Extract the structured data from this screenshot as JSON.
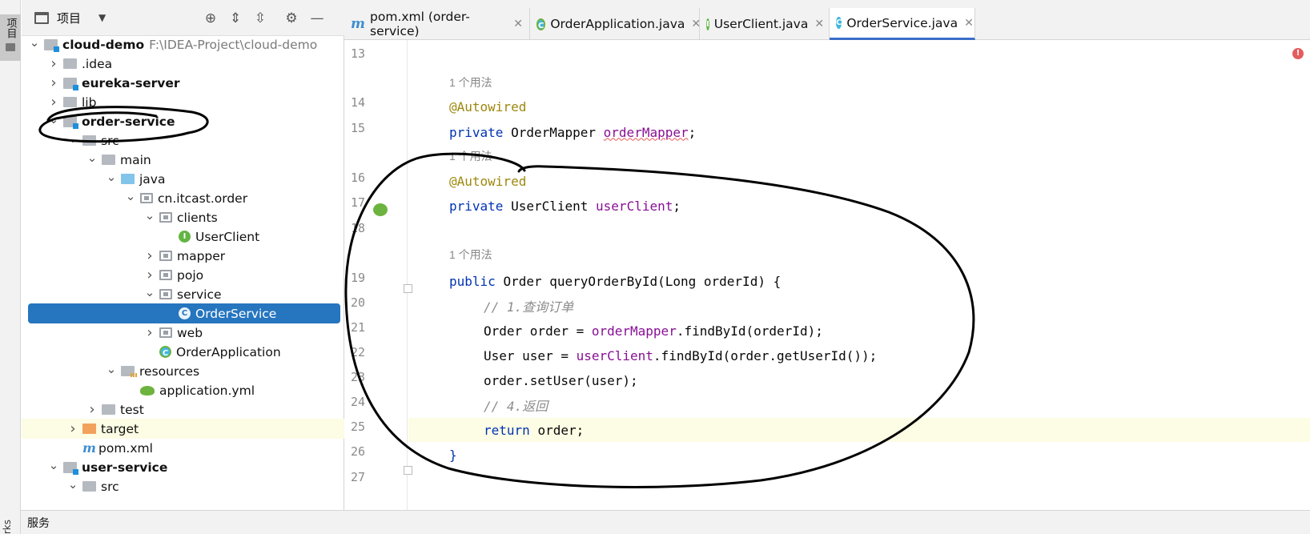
{
  "tool_strip": {
    "project_tab": "项目",
    "bottom_label": "rks"
  },
  "project_panel": {
    "title": "项目",
    "tree": [
      {
        "label": "cloud-demo",
        "path": "F:\\IDEA-Project\\cloud-demo",
        "bold": true,
        "expanded": true,
        "icon": "module-icon"
      },
      {
        "label": ".idea",
        "expanded": false,
        "icon": "folder-icon"
      },
      {
        "label": "eureka-server",
        "bold": true,
        "expanded": false,
        "icon": "module-icon"
      },
      {
        "label": "lib",
        "expanded": false,
        "icon": "folder-icon"
      },
      {
        "label": "order-service",
        "bold": true,
        "expanded": true,
        "icon": "module-icon"
      },
      {
        "label": "src",
        "expanded": true,
        "icon": "folder-icon"
      },
      {
        "label": "main",
        "expanded": true,
        "icon": "folder-icon"
      },
      {
        "label": "java",
        "expanded": true,
        "icon": "source-folder-icon"
      },
      {
        "label": "cn.itcast.order",
        "expanded": true,
        "icon": "package-icon"
      },
      {
        "label": "clients",
        "expanded": true,
        "icon": "package-icon"
      },
      {
        "label": "UserClient",
        "icon": "interface-icon"
      },
      {
        "label": "mapper",
        "expanded": false,
        "icon": "package-icon"
      },
      {
        "label": "pojo",
        "expanded": false,
        "icon": "package-icon"
      },
      {
        "label": "service",
        "expanded": true,
        "icon": "package-icon"
      },
      {
        "label": "OrderService",
        "icon": "class-icon",
        "selected": true
      },
      {
        "label": "web",
        "expanded": false,
        "icon": "package-icon"
      },
      {
        "label": "OrderApplication",
        "icon": "spring-class-icon"
      },
      {
        "label": "resources",
        "expanded": true,
        "icon": "resources-folder-icon"
      },
      {
        "label": "application.yml",
        "icon": "yml-icon"
      },
      {
        "label": "test",
        "expanded": false,
        "icon": "folder-icon"
      },
      {
        "label": "target",
        "expanded": false,
        "icon": "excluded-folder-icon"
      },
      {
        "label": "pom.xml",
        "icon": "maven-icon"
      },
      {
        "label": "user-service",
        "bold": true,
        "expanded": true,
        "icon": "module-icon"
      },
      {
        "label": "src",
        "expanded": true,
        "icon": "folder-icon"
      }
    ]
  },
  "tabs": [
    {
      "label": "pom.xml (order-service)",
      "icon": "maven-icon"
    },
    {
      "label": "OrderApplication.java",
      "icon": "spring-class-icon"
    },
    {
      "label": "UserClient.java",
      "icon": "interface-icon"
    },
    {
      "label": "OrderService.java",
      "icon": "class-icon",
      "active": true
    }
  ],
  "editor": {
    "line_numbers": [
      "13",
      "14",
      "15",
      "16",
      "17",
      "18",
      "19",
      "20",
      "21",
      "22",
      "23",
      "24",
      "25",
      "26",
      "27"
    ],
    "usage_hint": "1 个用法",
    "code": {
      "l14": "@Autowired",
      "l15a": "private ",
      "l15b": "OrderMapper ",
      "l15c": "orderMapper",
      "l15d": ";",
      "l16": "@Autowired",
      "l17a": "private ",
      "l17b": "UserClient ",
      "l17c": "userClient",
      "l17d": ";",
      "l19a": "public ",
      "l19b": "Order queryOrderById(Long orderId) {",
      "l20": "// 1.查询订单",
      "l21a": "Order order = ",
      "l21b": "orderMapper",
      "l21c": ".findById(orderId);",
      "l22a": "User user = ",
      "l22b": "userClient",
      "l22c": ".findById(order.getUserId());",
      "l23": "order.setUser(user);",
      "l24": "// 4.返回",
      "l25a": "return ",
      "l25b": "order;",
      "l26": "}"
    }
  },
  "statusbar": {
    "services_label": "服务"
  },
  "colors": {
    "keyword": "#0033b3",
    "annotation": "#9e880d",
    "field": "#871094",
    "comment": "#8c8c8c",
    "selection": "#2675bf",
    "current_line": "#fdfce4"
  }
}
